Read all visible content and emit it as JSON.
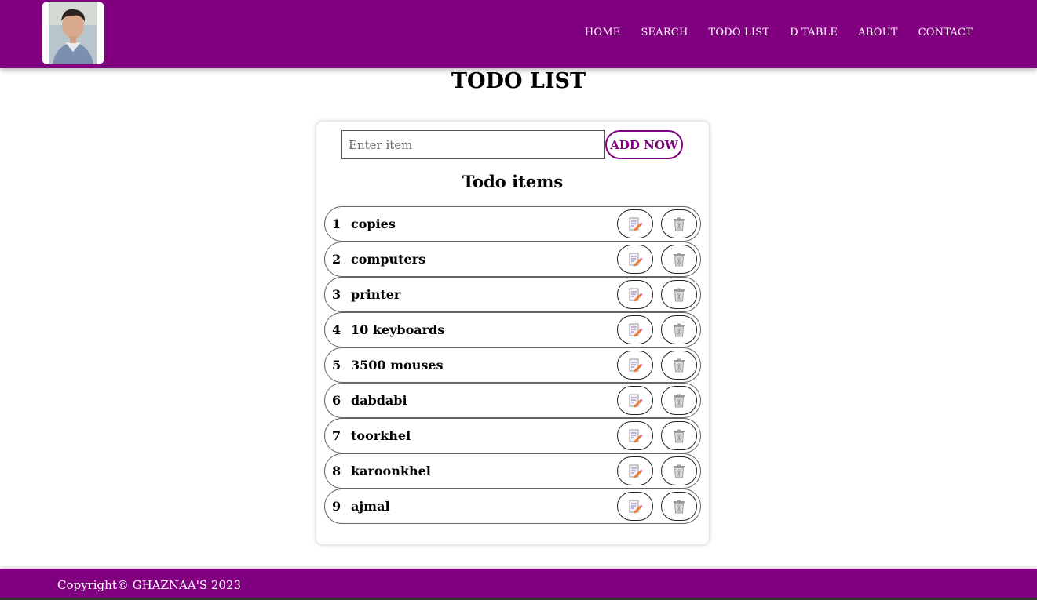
{
  "nav": {
    "items": [
      {
        "label": "HOME",
        "name": "nav-home"
      },
      {
        "label": "SEARCH",
        "name": "nav-search"
      },
      {
        "label": "TODO LIST",
        "name": "nav-todo-list"
      },
      {
        "label": "D TABLE",
        "name": "nav-d-table"
      },
      {
        "label": "ABOUT",
        "name": "nav-about"
      },
      {
        "label": "CONTACT",
        "name": "nav-contact"
      }
    ]
  },
  "page": {
    "title": "TODO LIST"
  },
  "form": {
    "input_value": "",
    "input_placeholder": "Enter item",
    "add_label": "ADD NOW"
  },
  "list": {
    "heading": "Todo items",
    "items": [
      {
        "index": "1",
        "text": "copies"
      },
      {
        "index": "2",
        "text": "computers"
      },
      {
        "index": "3",
        "text": "printer"
      },
      {
        "index": "4",
        "text": "10 keyboards"
      },
      {
        "index": "5",
        "text": "3500 mouses"
      },
      {
        "index": "6",
        "text": "dabdabi"
      },
      {
        "index": "7",
        "text": "toorkhel"
      },
      {
        "index": "8",
        "text": "karoonkhel"
      },
      {
        "index": "9",
        "text": "ajmal"
      }
    ],
    "edit_icon": "edit-icon",
    "delete_icon": "trash-icon"
  },
  "footer": {
    "copyright": "Copyright© GHAZNAA'S 2023"
  },
  "colors": {
    "brand": "#800080",
    "white": "#ffffff"
  }
}
